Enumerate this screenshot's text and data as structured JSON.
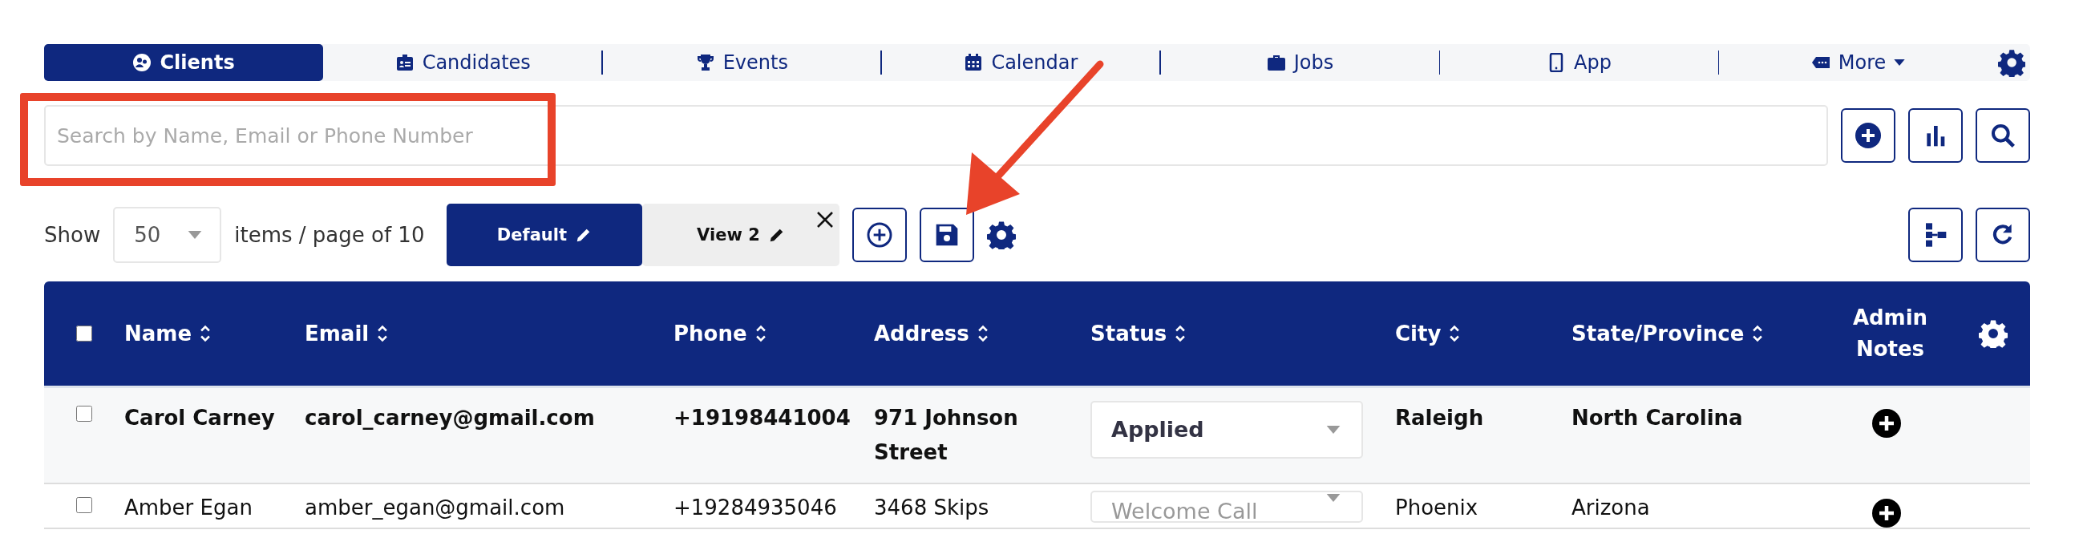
{
  "nav": {
    "tabs": [
      {
        "label": "Clients",
        "selected": true,
        "dropdown": false
      },
      {
        "label": "Candidates",
        "selected": false,
        "dropdown": false
      },
      {
        "label": "Events",
        "selected": false,
        "dropdown": false
      },
      {
        "label": "Calendar",
        "selected": false,
        "dropdown": false
      },
      {
        "label": "Jobs",
        "selected": false,
        "dropdown": false
      },
      {
        "label": "App",
        "selected": false,
        "dropdown": false
      },
      {
        "label": "More",
        "selected": false,
        "dropdown": true
      }
    ]
  },
  "search": {
    "placeholder": "Search by Name, Email or Phone Number"
  },
  "pager": {
    "show_label": "Show",
    "page_size": "50",
    "suffix": "items / page of 10"
  },
  "views": [
    {
      "label": "Default",
      "selected": true,
      "closable": false
    },
    {
      "label": "View 2",
      "selected": false,
      "closable": true
    }
  ],
  "table": {
    "select_all_checked": false,
    "columns": [
      {
        "label": "Name",
        "sortable": true
      },
      {
        "label": "Email",
        "sortable": true
      },
      {
        "label": "Phone",
        "sortable": true
      },
      {
        "label": "Address",
        "sortable": true
      },
      {
        "label": "Status",
        "sortable": true
      },
      {
        "label": "City",
        "sortable": true
      },
      {
        "label": "State/Province",
        "sortable": true
      },
      {
        "label": "Admin Notes",
        "sortable": false
      }
    ],
    "rows": [
      {
        "checked": false,
        "bold": true,
        "name": "Carol Carney",
        "email": "carol_carney@gmail.com",
        "phone": "+19198441004",
        "address": "971 Johnson Street",
        "status": "Applied",
        "city": "Raleigh",
        "state": "North Carolina"
      },
      {
        "checked": false,
        "bold": false,
        "name": "Amber Egan",
        "email": "amber_egan@gmail.com",
        "phone": "+19284935046",
        "address": "3468 Skips",
        "status": "Welcome Call",
        "city": "Phoenix",
        "state": "Arizona"
      }
    ]
  }
}
